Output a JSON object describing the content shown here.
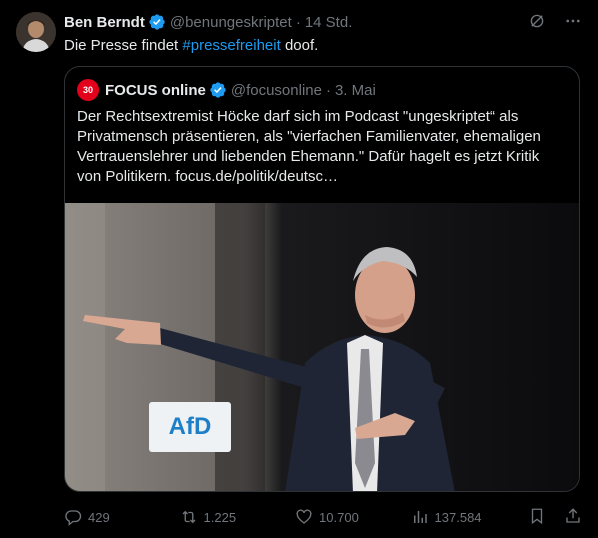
{
  "post": {
    "author_name": "Ben Berndt",
    "author_handle": "@benungeskriptet",
    "time": "14 Std.",
    "text_before": "Die Presse findet ",
    "hashtag": "#pressefreiheit",
    "text_after": " doof."
  },
  "quote": {
    "logo_text": "30",
    "author_name": "FOCUS online",
    "author_handle": "@focusonline",
    "time": "3. Mai",
    "text": "Der Rechtsextremist Höcke darf sich im Podcast \"ungeskriptet“ als Privatmensch präsentieren, als \"vierfachen Familienvater, ehemaligen Vertrauenslehrer und liebenden Ehemann.\" Dafür hagelt es jetzt Kritik von Politikern. focus.de/politik/deutsc…",
    "image_sign_text": "AfD"
  },
  "actions": {
    "replies": "429",
    "reposts": "1.225",
    "likes": "10.700",
    "views": "137.584"
  },
  "icons": {
    "verified": "verified-badge-icon",
    "grok": "grok-icon",
    "more": "more-icon",
    "reply": "reply-icon",
    "repost": "repost-icon",
    "like": "like-icon",
    "views": "views-icon",
    "bookmark": "bookmark-icon",
    "share": "share-icon"
  },
  "colors": {
    "background": "#000000",
    "text": "#e7e9ea",
    "muted": "#71767b",
    "accent": "#1d9bf0",
    "border": "#2f3336",
    "focus_red": "#e2001a"
  }
}
